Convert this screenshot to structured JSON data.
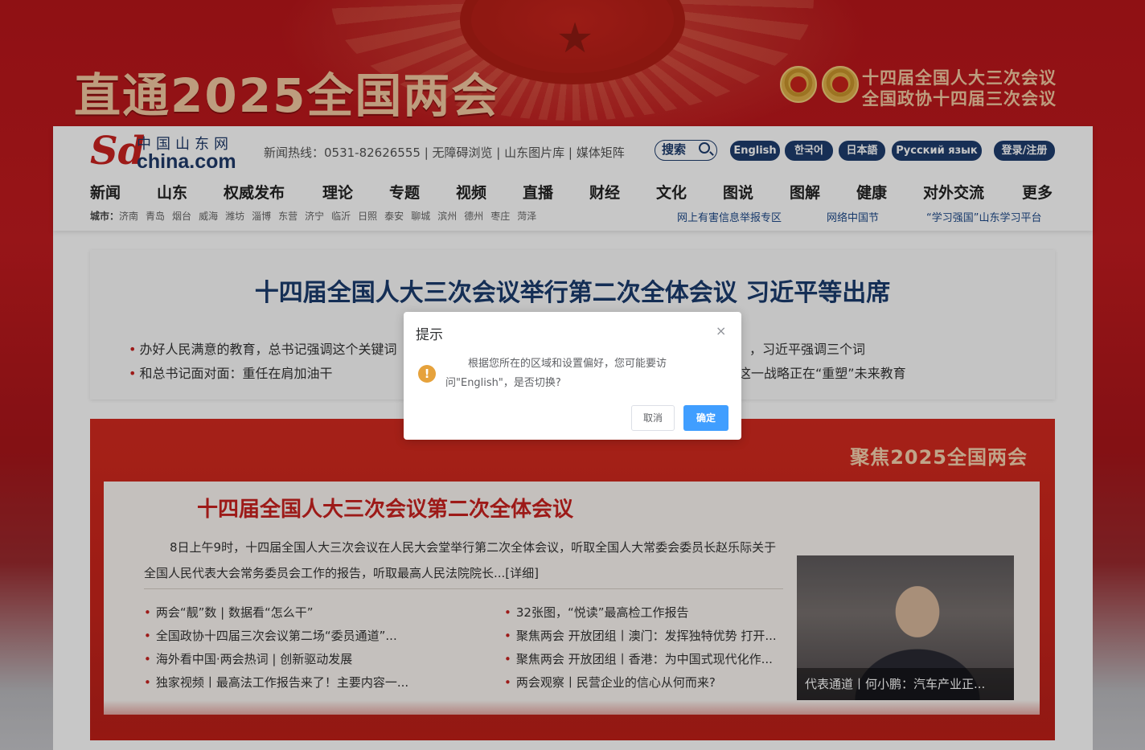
{
  "banner": {
    "title": "直通2025全国两会",
    "right_line1": "十四届全国人大三次会议",
    "right_line2": "全国政协十四届三次会议"
  },
  "header": {
    "logo_cn": "中国山东网",
    "logo_mark": "Sd",
    "logo_domain": "china.com",
    "hotline": "新闻热线：0531-82626555 | 无障碍浏览 | 山东图片库 | 媒体矩阵",
    "search_label": "搜索",
    "languages": [
      "English",
      "한국어",
      "日本語",
      "Русский язык"
    ],
    "login_label": "登录/注册"
  },
  "nav": {
    "items": [
      "新闻",
      "山东",
      "权威发布",
      "理论",
      "专题",
      "视频",
      "直播",
      "财经",
      "文化",
      "图说",
      "图解",
      "健康",
      "对外交流",
      "更多"
    ],
    "cities_label": "城市：",
    "cities": [
      "济南",
      "青岛",
      "烟台",
      "威海",
      "潍坊",
      "淄博",
      "东营",
      "济宁",
      "临沂",
      "日照",
      "泰安",
      "聊城",
      "滨州",
      "德州",
      "枣庄",
      "菏泽"
    ],
    "sublinks": [
      "网上有害信息举报专区",
      "网络中国节",
      "“学习强国”山东学习平台"
    ]
  },
  "headline": {
    "title": "十四届全国人大三次会议举行第二次全体会议 习近平等出席",
    "items": [
      "办好人民满意的教育，总书记强调这个关键词",
      "和总书记面对面：重任在肩加油干",
      "，习近平强调三个词",
      "这一战略正在“重塑”未来教育"
    ]
  },
  "focus": {
    "section_title": "聚焦2025全国两会",
    "title": "十四届全国人大三次会议第二次全体会议",
    "paragraph": "8日上午9时，十四届全国人大三次会议在人民大会堂举行第二次全体会议，听取全国人大常委会委员长赵乐际关于全国人民代表大会常务委员会工作的报告，听取最高人民法院院长...[详细]",
    "left_items": [
      "两会“靓”数 | 数据看“怎么干”",
      "全国政协十四届三次会议第二场“委员通道”...",
      "海外看中国·两会热词 | 创新驱动发展",
      "独家视频丨最高法工作报告来了！主要内容一..."
    ],
    "right_items": [
      "32张图，“悦读”最高检工作报告",
      "聚焦两会 开放团组丨澳门：发挥独特优势 打开...",
      "聚焦两会 开放团组丨香港：为中国式现代化作...",
      "两会观察丨民营企业的信心从何而来?"
    ],
    "photo_caption": "代表通道丨何小鹏：汽车产业正..."
  },
  "dialog": {
    "title": "提示",
    "close": "×",
    "icon": "!",
    "message": "根据您所在的区域和设置偏好，您可能要访问\"English\"，是否切换?",
    "cancel_label": "取消",
    "confirm_label": "确定"
  },
  "colors": {
    "brand_red": "#c9221f",
    "brand_navy": "#1e3d6e",
    "dialog_primary": "#409eff",
    "warning": "#e6a23c"
  }
}
